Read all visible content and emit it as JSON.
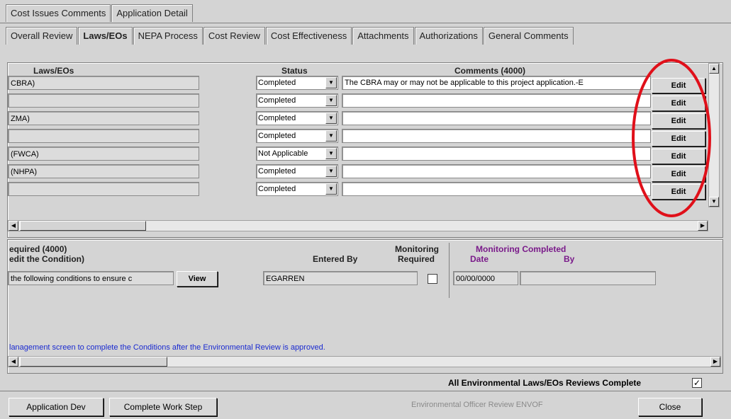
{
  "outer_tabs": [
    "Cost Issues Comments",
    "Application Detail"
  ],
  "inner_tabs": [
    {
      "label": "Overall Review",
      "active": false
    },
    {
      "label": "Laws/EOs",
      "active": true
    },
    {
      "label": "NEPA Process",
      "active": false
    },
    {
      "label": "Cost Review",
      "active": false
    },
    {
      "label": "Cost Effectiveness",
      "active": false
    },
    {
      "label": "Attachments",
      "active": false
    },
    {
      "label": "Authorizations",
      "active": false
    },
    {
      "label": "General Comments",
      "active": false
    }
  ],
  "grid": {
    "headers": {
      "laws": "Laws/EOs",
      "status": "Status",
      "comments": "Comments (4000)"
    },
    "edit_label": "Edit",
    "rows": [
      {
        "law": "CBRA)",
        "status": "Completed",
        "comment": "The CBRA may or may not be applicable to this project application.-E"
      },
      {
        "law": "",
        "status": "Completed",
        "comment": ""
      },
      {
        "law": "ZMA)",
        "status": "Completed",
        "comment": ""
      },
      {
        "law": "",
        "status": "Completed",
        "comment": ""
      },
      {
        "law": " (FWCA)",
        "status": "Not Applicable",
        "comment": ""
      },
      {
        "law": " (NHPA)",
        "status": "Completed",
        "comment": ""
      },
      {
        "law": "",
        "status": "Completed",
        "comment": ""
      }
    ]
  },
  "conditions": {
    "header_required": "equired (4000)",
    "header_edit": "edit the Condition)",
    "header_entered_by": "Entered By",
    "header_monitoring": "Monitoring",
    "header_required2": "Required",
    "header_monitoring_completed": "Monitoring Completed",
    "header_date": "Date",
    "header_by": "By",
    "condition_text": "the following conditions to ensure c",
    "view_label": "View",
    "entered_by": "EGARREN",
    "date": "00/00/0000",
    "by": "",
    "note": "lanagement screen to complete the Conditions after the Environmental Review is approved."
  },
  "footer": {
    "all_complete_label": "All Environmental Laws/EOs Reviews Complete",
    "all_complete_checked": "✓",
    "app_dev_label": "Application Dev",
    "complete_step_label": "Complete Work Step",
    "status_text": "Environmental Officer Review  ENVOF",
    "close_label": "Close"
  },
  "colors": {
    "highlight_circle": "#e0101a",
    "purple": "#7a1a8a",
    "blue": "#1a2ad0"
  }
}
